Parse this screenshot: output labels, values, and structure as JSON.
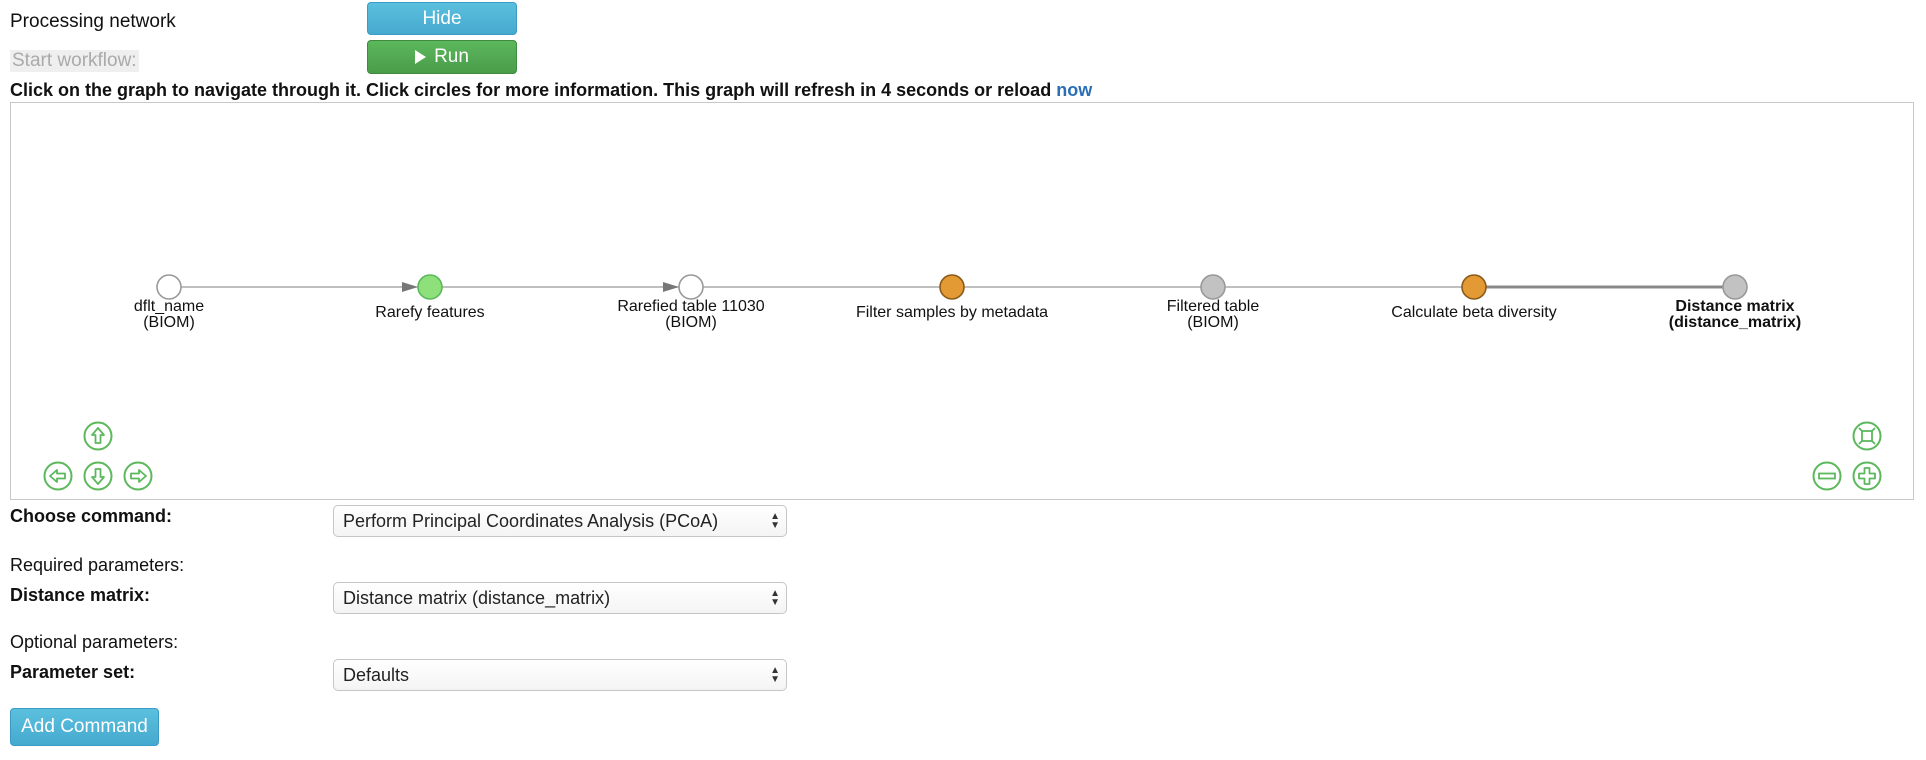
{
  "processing": {
    "label": "Processing network",
    "hide_label": "Hide"
  },
  "workflow": {
    "label": "Start workflow:",
    "run_label": "Run"
  },
  "instructions": {
    "text": "Click on the graph to navigate through it. Click circles for more information. This graph will refresh in 4 seconds or reload ",
    "link": "now"
  },
  "graph": {
    "nodes": [
      {
        "line1": "dflt_name",
        "line2": "(BIOM)",
        "fill": "#ffffff",
        "stroke": "#999999",
        "bold": false
      },
      {
        "line1": "Rarefy features",
        "line2": "",
        "fill": "#8ee07a",
        "stroke": "#5cb85c",
        "bold": false
      },
      {
        "line1": "Rarefied table 11030",
        "line2": "(BIOM)",
        "fill": "#ffffff",
        "stroke": "#999999",
        "bold": false
      },
      {
        "line1": "Filter samples by metadata",
        "line2": "",
        "fill": "#e39a35",
        "stroke": "#8a5a1a",
        "bold": false
      },
      {
        "line1": "Filtered table",
        "line2": "(BIOM)",
        "fill": "#c2c2c2",
        "stroke": "#999999",
        "bold": false
      },
      {
        "line1": "Calculate beta diversity",
        "line2": "",
        "fill": "#e39a35",
        "stroke": "#8a5a1a",
        "bold": false
      },
      {
        "line1": "Distance matrix",
        "line2": "(distance_matrix)",
        "fill": "#c2c2c2",
        "stroke": "#999999",
        "bold": true
      }
    ],
    "nav_icons": [
      "arrow-up-icon",
      "arrow-left-icon",
      "arrow-down-icon",
      "arrow-right-icon"
    ],
    "zoom_icons": [
      "fit-screen-icon",
      "zoom-out-icon",
      "zoom-in-icon"
    ],
    "icon_color": "#5cb85c"
  },
  "form": {
    "choose_command_label": "Choose command:",
    "choose_command_value": "Perform Principal Coordinates Analysis (PCoA)",
    "required_label": "Required parameters:",
    "distance_label": "Distance matrix:",
    "distance_value": "Distance matrix (distance_matrix)",
    "optional_label": "Optional parameters:",
    "paramset_label": "Parameter set:",
    "paramset_value": "Defaults",
    "add_button": "Add Command"
  },
  "colors": {
    "link": "#2a6fb5",
    "muted": "#aaaaaa"
  }
}
